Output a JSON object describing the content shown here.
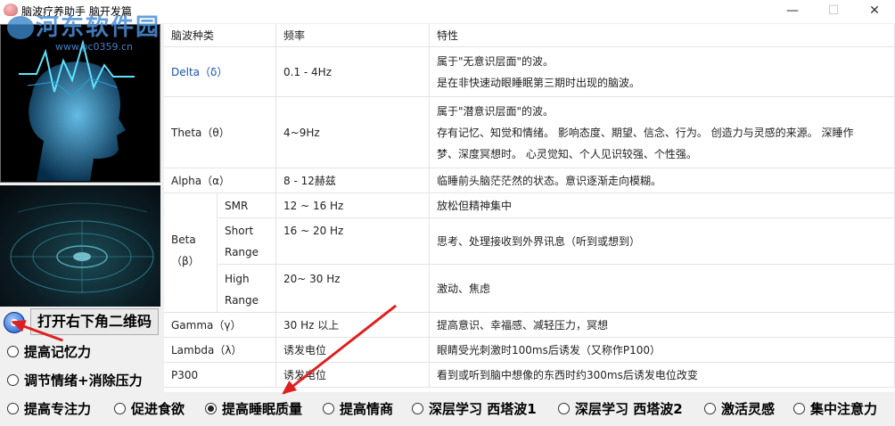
{
  "window": {
    "title": "脑波疗养助手 脑开发篇",
    "min_glyph": "—",
    "max_glyph": "☐",
    "close_glyph": "✕"
  },
  "watermark": {
    "title": "河东软件园",
    "url": "www.pc0359.cn"
  },
  "table": {
    "headers": [
      "脑波种类",
      "频率",
      "特性"
    ],
    "rows": [
      {
        "name": "Delta（δ）",
        "freq": "0.1 - 4Hz",
        "lines": [
          "属于\"无意识层面\"的波。",
          "是在非快速动眼睡眠第三期时出现的脑波。"
        ]
      },
      {
        "name": "Theta（θ）",
        "freq": "4~9Hz",
        "lines": [
          "属于\"潜意识层面\"的波。",
          "存有记忆、知觉和情绪。 影响态度、期望、信念、行为。 创造力与灵感的来源。 深睡作",
          "梦、深度冥想时。 心灵觉知、个人见识较强、个性强。"
        ]
      },
      {
        "name": "Alpha（α）",
        "freq": "8 - 12赫兹",
        "lines": [
          "临睡前头脑茫茫然的状态。意识逐渐走向模糊。"
        ]
      },
      {
        "name": "Beta",
        "name2": "（β）",
        "subs": [
          {
            "sub": "SMR",
            "freq": "12 ~ 16 Hz",
            "lines": [
              "放松但精神集中"
            ]
          },
          {
            "sub": "Short",
            "sub2": "Range",
            "freq": "16 ~ 20 Hz",
            "lines": [
              "思考、处理接收到外界讯息（听到或想到）"
            ]
          },
          {
            "sub": "High",
            "sub2": "Range",
            "freq": "20~ 30 Hz",
            "lines": [
              "激动、焦虑"
            ]
          }
        ]
      },
      {
        "name": "Gamma（γ）",
        "freq": "30 Hz 以上",
        "lines": [
          "提高意识、幸福感、减轻压力，冥想"
        ]
      },
      {
        "name": "Lambda（λ）",
        "freq": "诱发电位",
        "lines": [
          "眼睛受光刺激时100ms后诱发（又称作P100）"
        ]
      },
      {
        "name": "P300",
        "freq": "诱发电位",
        "lines": [
          "看到或听到脑中想像的东西时约300ms后诱发电位改变"
        ]
      }
    ]
  },
  "qr_button": "打开右下角二维码",
  "left_radios": [
    "提高记忆力",
    "调节情绪+消除压力"
  ],
  "bottom_radios": [
    {
      "label": "提高专注力",
      "checked": false
    },
    {
      "label": "促进食欲",
      "checked": false
    },
    {
      "label": "提高睡眠质量",
      "checked": true
    },
    {
      "label": "提高情商",
      "checked": false
    },
    {
      "label": "深层学习 西塔波1",
      "checked": false
    },
    {
      "label": "深层学习 西塔波2",
      "checked": false
    },
    {
      "label": "激活灵感",
      "checked": false
    },
    {
      "label": "集中注意力",
      "checked": false
    }
  ],
  "colors": {
    "accent": "#1a52b3",
    "arrow": "#e02020"
  }
}
